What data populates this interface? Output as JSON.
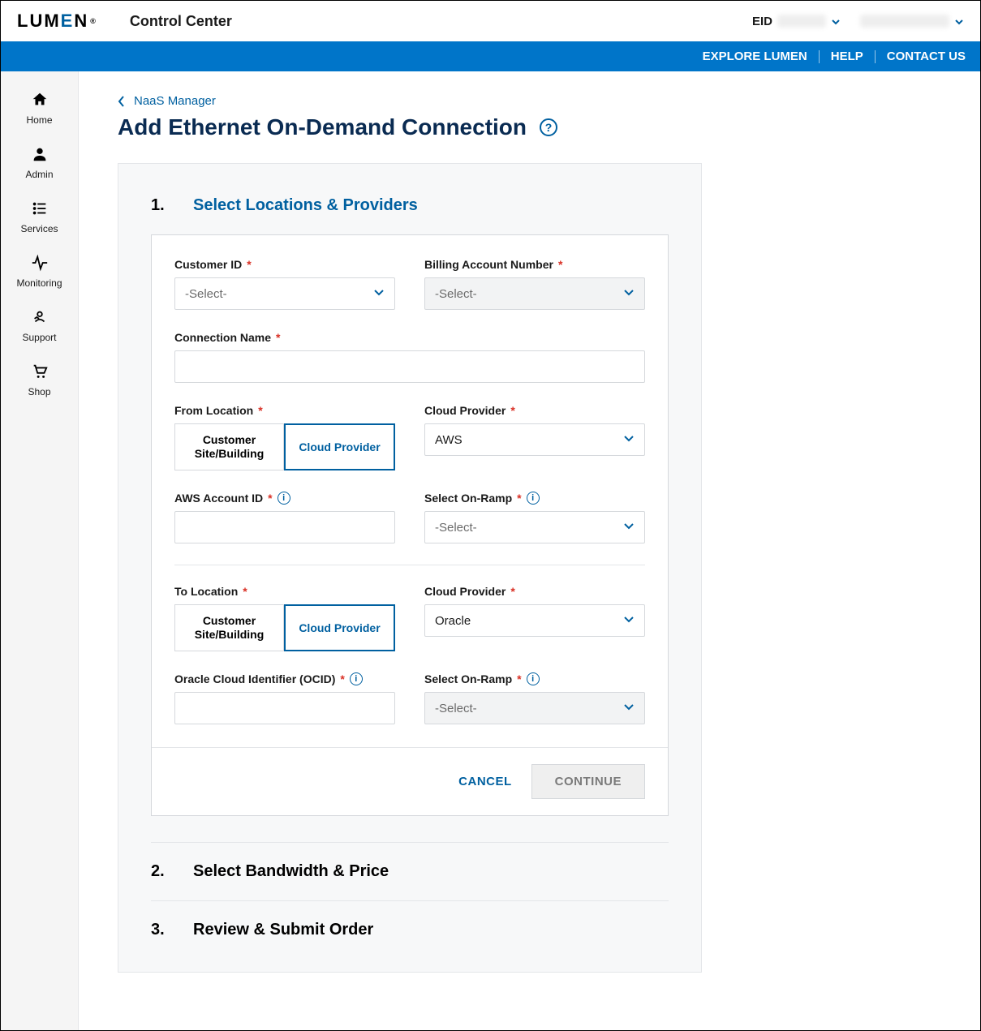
{
  "header": {
    "logo_prefix": "LUM",
    "logo_e": "E",
    "logo_suffix": "N",
    "app_title": "Control Center",
    "eid_label": "EID"
  },
  "blue_bar": {
    "explore": "EXPLORE LUMEN",
    "help": "HELP",
    "contact": "CONTACT US"
  },
  "nav": {
    "home": "Home",
    "admin": "Admin",
    "services": "Services",
    "monitoring": "Monitoring",
    "support": "Support",
    "shop": "Shop"
  },
  "breadcrumb": {
    "back": "NaaS Manager"
  },
  "page": {
    "title": "Add Ethernet On-Demand Connection"
  },
  "steps": {
    "s1_num": "1.",
    "s1_title": "Select Locations & Providers",
    "s2_num": "2.",
    "s2_title": "Select Bandwidth & Price",
    "s3_num": "3.",
    "s3_title": "Review & Submit Order"
  },
  "form": {
    "customer_id_label": "Customer ID",
    "customer_id_placeholder": "-Select-",
    "ban_label": "Billing Account Number",
    "ban_placeholder": "-Select-",
    "connection_name_label": "Connection Name",
    "from_location_label": "From Location",
    "to_location_label": "To Location",
    "toggle_customer": "Customer Site/Building",
    "toggle_cloud": "Cloud Provider",
    "cloud_provider_label": "Cloud Provider",
    "from_provider_value": "AWS",
    "to_provider_value": "Oracle",
    "aws_account_label": "AWS Account ID",
    "onramp_label": "Select On-Ramp",
    "onramp_placeholder": "-Select-",
    "ocid_label": "Oracle Cloud Identifier (OCID)"
  },
  "buttons": {
    "cancel": "CANCEL",
    "continue": "CONTINUE"
  }
}
